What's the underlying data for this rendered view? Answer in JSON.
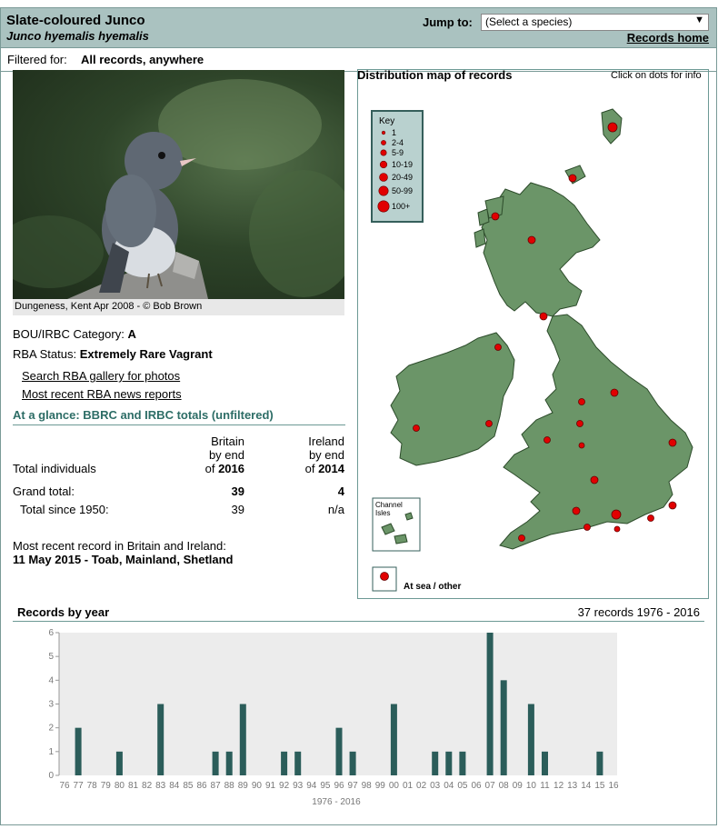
{
  "header": {
    "common_name": "Slate-coloured Junco",
    "scientific_name": "Junco hyemalis hyemalis",
    "jump_label": "Jump to:",
    "jump_select_value": "(Select a species)",
    "records_home": "Records home"
  },
  "filter": {
    "label": "Filtered for:",
    "value": "All records, anywhere"
  },
  "photo": {
    "caption": "Dungeness, Kent Apr 2008 - © Bob Brown"
  },
  "info": {
    "category_label": "BOU/IRBC Category:",
    "category_value": "A",
    "status_label": "RBA Status:",
    "status_value": "Extremely Rare Vagrant",
    "link_gallery": "Search RBA gallery for photos",
    "link_news": "Most recent RBA news reports"
  },
  "glance": {
    "title": "At a glance: BBRC and IRBC totals (unfiltered)",
    "britain_head1": "Britain",
    "britain_head2": "by end",
    "britain_head3_pre": "of",
    "britain_year": "2016",
    "ireland_head1": "Ireland",
    "ireland_head2": "by end",
    "ireland_head3_pre": "of",
    "ireland_year": "2014",
    "total_individuals": "Total individuals",
    "grand_total_label": "Grand total:",
    "grand_total_britain": "39",
    "grand_total_ireland": "4",
    "since1950_label": "Total since 1950:",
    "since1950_britain": "39",
    "since1950_ireland": "n/a",
    "recent_label": "Most recent record in Britain and Ireland:",
    "recent_value": "11 May 2015  - Toab, Mainland, Shetland"
  },
  "map": {
    "title": "Distribution map of records",
    "hint": "Click on dots for info",
    "key_title": "Key",
    "key_items": [
      "1",
      "2-4",
      "5-9",
      "10-19",
      "20-49",
      "50-99",
      "100+"
    ],
    "channel_islands": [
      "Channel",
      "Isles"
    ],
    "at_sea": "At sea / other",
    "land_color": "#6b9568",
    "dot_color": "#e10000"
  },
  "records_by_year": {
    "title": "Records by year",
    "summary": "37 records 1976 - 2016"
  },
  "chart_data": {
    "type": "bar",
    "categories": [
      "76",
      "77",
      "78",
      "79",
      "80",
      "81",
      "82",
      "83",
      "84",
      "85",
      "86",
      "87",
      "88",
      "89",
      "90",
      "91",
      "92",
      "93",
      "94",
      "95",
      "96",
      "97",
      "98",
      "99",
      "00",
      "01",
      "02",
      "03",
      "04",
      "05",
      "06",
      "07",
      "08",
      "09",
      "10",
      "11",
      "12",
      "13",
      "14",
      "15",
      "16"
    ],
    "values": [
      0,
      2,
      0,
      0,
      1,
      0,
      0,
      3,
      0,
      0,
      0,
      1,
      1,
      3,
      0,
      0,
      1,
      1,
      0,
      0,
      2,
      1,
      0,
      0,
      3,
      0,
      0,
      1,
      1,
      1,
      0,
      6,
      4,
      0,
      3,
      1,
      0,
      0,
      0,
      1,
      0
    ],
    "xlabel": "1976 - 2016",
    "ylabel": "",
    "ylim": [
      0,
      6
    ],
    "yticks": [
      "0",
      "1",
      "2",
      "3",
      "4",
      "5",
      "6"
    ],
    "bar_color": "#2b5d5a",
    "background": "#ececec"
  }
}
